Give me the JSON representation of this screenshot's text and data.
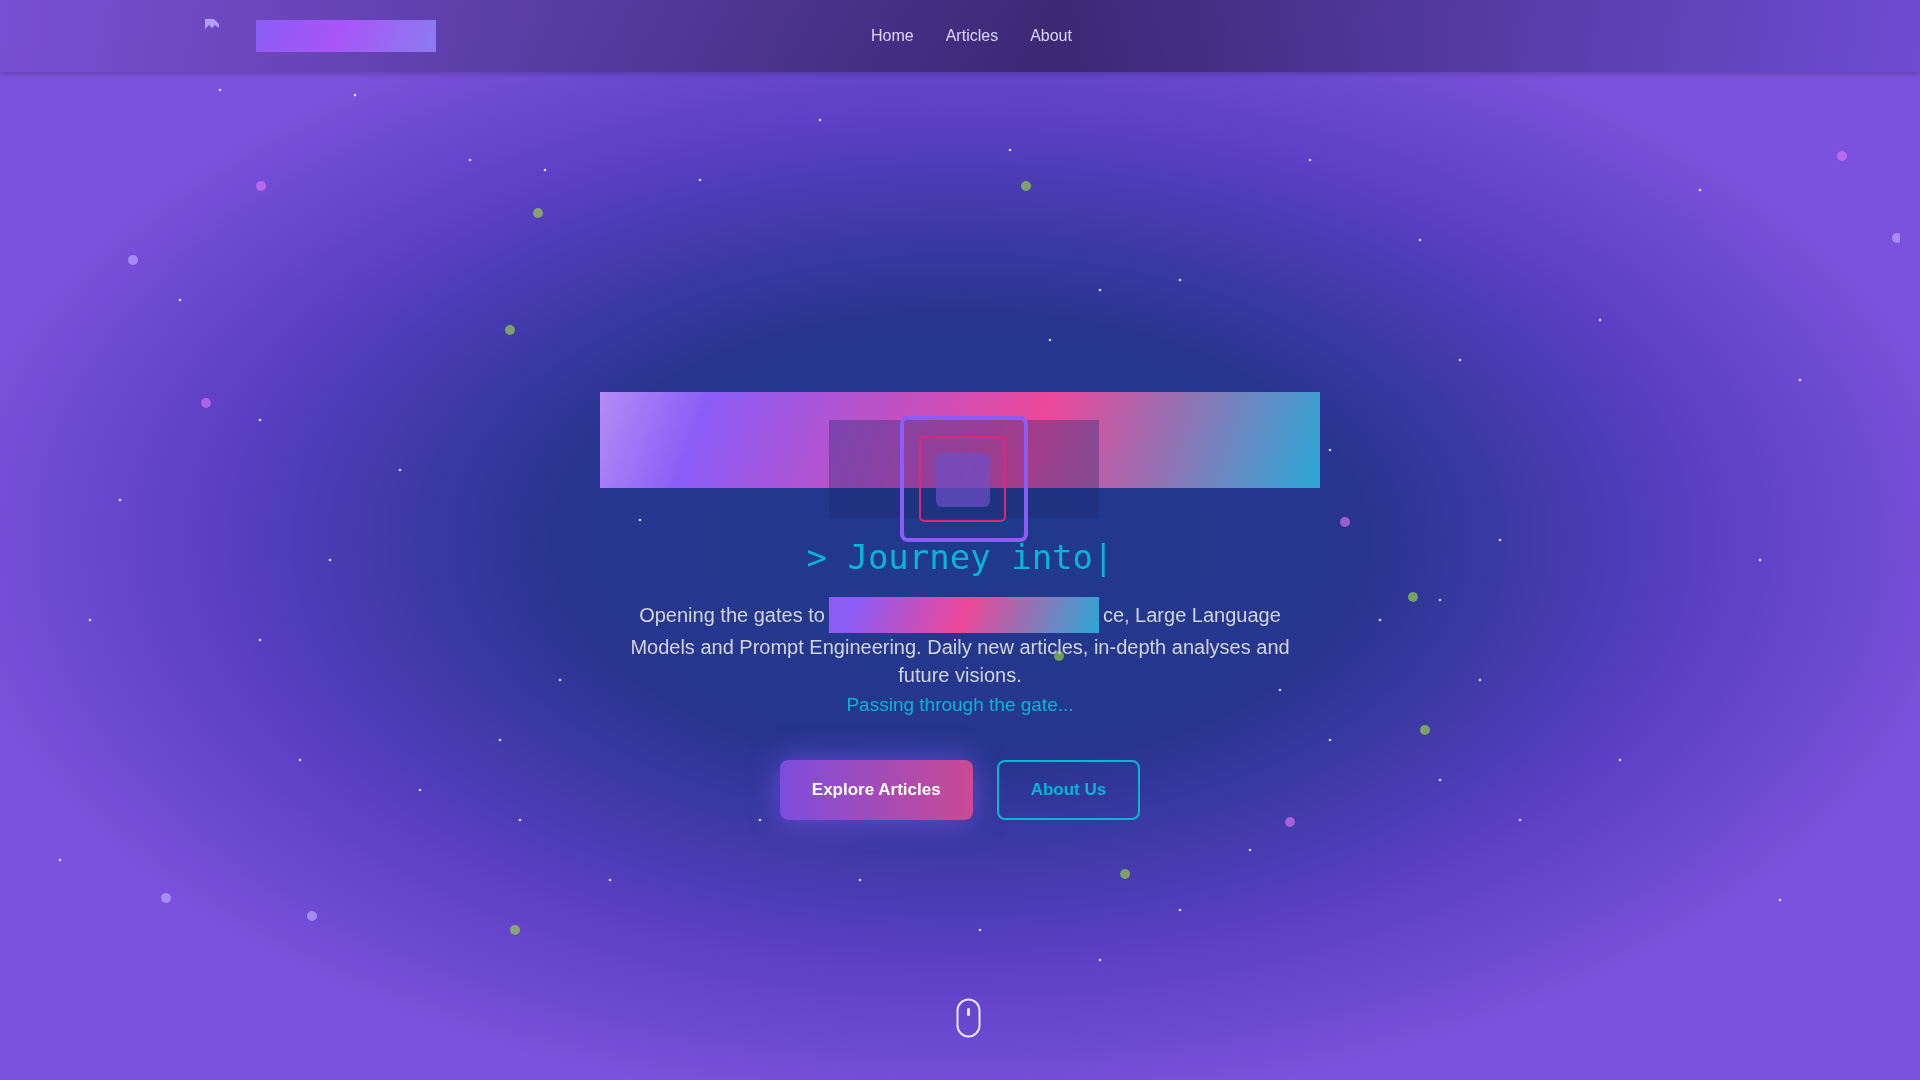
{
  "nav": {
    "items": [
      {
        "label": "Home",
        "selected": false
      },
      {
        "label": "Articles",
        "selected": false
      },
      {
        "label": "About",
        "selected": false
      }
    ]
  },
  "hero": {
    "heading": "> Journey into",
    "cursor": "|",
    "intro_visible_start": "Opening the gates to",
    "intro_visible_end": "ce, Large Language",
    "intro_line_2": "Models and Prompt Engineering. Daily new articles, in-depth analyses and",
    "intro_line_3": "future visions.",
    "loader_text": "Passing through the gate...",
    "buttons": [
      {
        "label": "Explore Articles",
        "kind": "primary"
      },
      {
        "label": "About Us",
        "kind": "outline"
      }
    ]
  }
}
